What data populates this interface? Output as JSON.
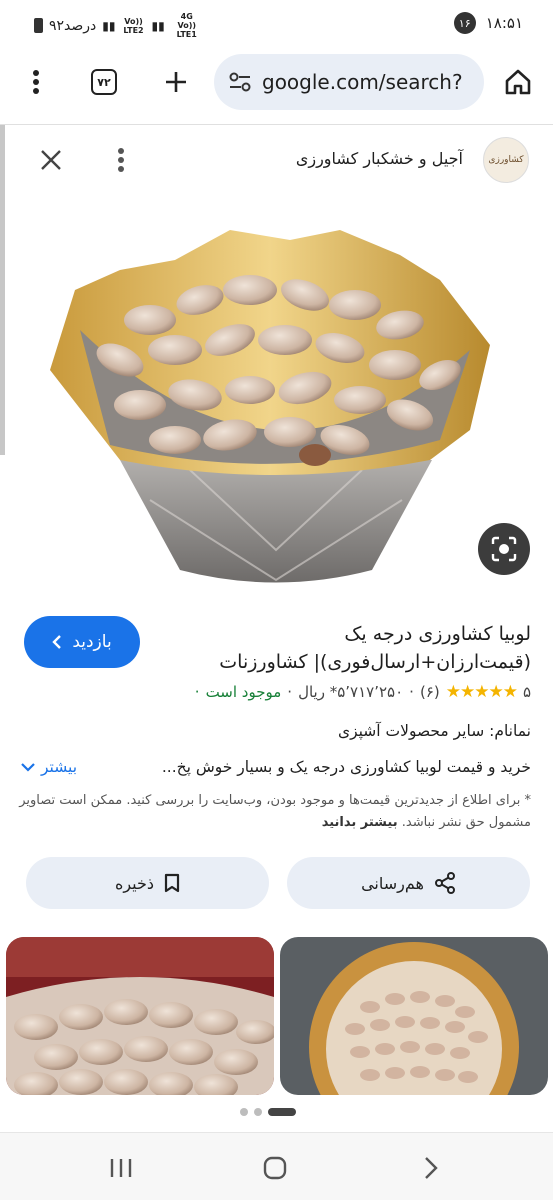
{
  "status_bar": {
    "time": "۱۸:۵۱",
    "notification_count": "۱۶",
    "battery": "۹۲درصد",
    "net1": "Vo)) LTE2",
    "net2": "4G Vo)) LTE1"
  },
  "browser": {
    "tab_count": "۷۲",
    "url": "google.com/search?"
  },
  "viewer": {
    "source_name": "آجیل و خشکبار کشاورزی",
    "logo_text": "کشاورزی"
  },
  "result": {
    "visit_label": "بازدید",
    "title": "لوبیا کشاورزی درجه یک (قیمت‌ارزان+ارسال‌فوری)| کشاورزنات",
    "rating": "۵",
    "stars": "★★★★★",
    "review_count": "(۶)",
    "price": "۵٬۷۱۷٬۲۵۰* ریال",
    "stock": "موجود است",
    "brand": "نمانام: سایر محصولات آشپزی",
    "description": "خرید و قیمت لوبیا کشاورزی درجه یک و بسیار خوش پخ...",
    "more_label": "بیشتر",
    "disclaimer": "* برای اطلاع از جدیدترین قیمت‌ها و موجود بودن، وب‌سایت را بررسی کنید. ممکن است تصاویر مشمول حق نشر نباشد.",
    "learn_more": "بیشتر بدانید"
  },
  "actions": {
    "share_label": "هم‌رسانی",
    "save_label": "ذخیره"
  },
  "colors": {
    "accent": "#1a73e8",
    "star": "#f4b400",
    "stock": "#188038",
    "pill_bg": "#e9eef6"
  }
}
